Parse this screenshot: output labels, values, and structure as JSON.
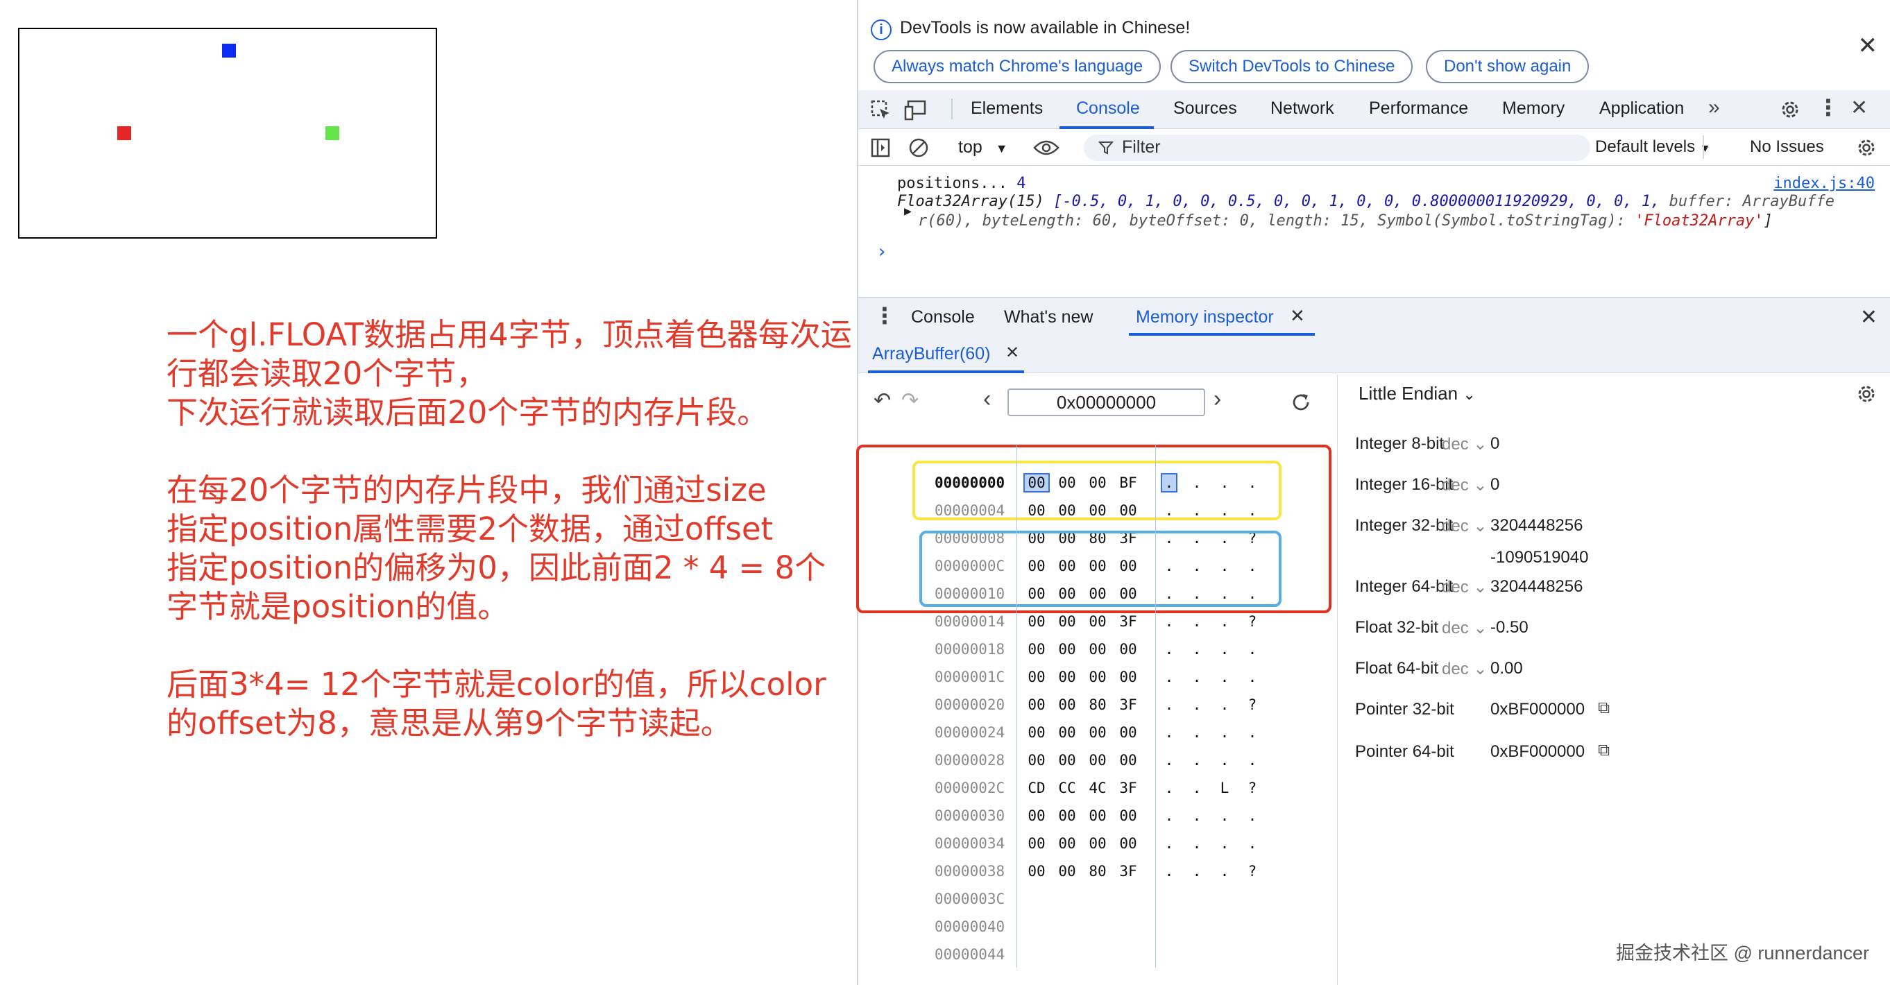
{
  "colors": {
    "annotation": "#e13a2a",
    "accent": "#1a5dd8",
    "square_blue": "#0a2cf0",
    "square_red": "#e32727",
    "square_green": "#66e64a",
    "highlight_yellow": "#f7e645",
    "highlight_blue": "#56aee6",
    "highlight_red": "#e0331f"
  },
  "annotation": {
    "p1": "一个gl.FLOAT数据占用4字节，顶点着色器每次运行都会读取20个字节，\n下次运行就读取后面20个字节的内存片段。",
    "p2": "在每20个字节的内存片段中，我们通过size\n指定position属性需要2个数据，通过offset\n指定position的偏移为0，因此前面2 * 4 = 8个\n字节就是position的值。",
    "p3": "后面3*4= 12个字节就是color的值，所以color\n的offset为8，意思是从第9个字节读起。"
  },
  "infobar": {
    "message": "DevTools is now available in Chinese!",
    "btn_match": "Always match Chrome's language",
    "btn_switch": "Switch DevTools to Chinese",
    "btn_dont": "Don't show again"
  },
  "tabs": {
    "elements": "Elements",
    "console": "Console",
    "sources": "Sources",
    "network": "Network",
    "performance": "Performance",
    "memory": "Memory",
    "application": "Application"
  },
  "toolbar": {
    "context": "top",
    "filter": "Filter",
    "levels": "Default levels",
    "issues": "No Issues"
  },
  "console": {
    "log_label": "positions...",
    "log_value": "4",
    "source_link": "index.js:40",
    "line1_type": "Float32Array(15)",
    "line1_values": "[-0.5, 0, 1, 0, 0, 0.5, 0, 0, 1, 0, 0, 0.800000011920929, 0, 0, 1,",
    "line1_tail": "buffer: ArrayBuffe",
    "line2": "r(60), byteLength: 60, byteOffset: 0, length: 15, Symbol(Symbol.toStringTag): ",
    "line2_str": "'Float32Array'",
    "line2_end": "]"
  },
  "drawer": {
    "tab_console": "Console",
    "tab_whatsnew": "What's new",
    "tab_memory": "Memory inspector",
    "subtab": "ArrayBuffer(60)"
  },
  "memory": {
    "address": "0x00000000",
    "endianness": "Little Endian",
    "rows": [
      {
        "addr": "00000000",
        "bytes": [
          "00",
          "00",
          "00",
          "BF"
        ],
        "ascii": [
          ".",
          ".",
          ".",
          "."
        ]
      },
      {
        "addr": "00000004",
        "bytes": [
          "00",
          "00",
          "00",
          "00"
        ],
        "ascii": [
          ".",
          ".",
          ".",
          "."
        ]
      },
      {
        "addr": "00000008",
        "bytes": [
          "00",
          "00",
          "80",
          "3F"
        ],
        "ascii": [
          ".",
          ".",
          ".",
          "?"
        ]
      },
      {
        "addr": "0000000C",
        "bytes": [
          "00",
          "00",
          "00",
          "00"
        ],
        "ascii": [
          ".",
          ".",
          ".",
          "."
        ]
      },
      {
        "addr": "00000010",
        "bytes": [
          "00",
          "00",
          "00",
          "00"
        ],
        "ascii": [
          ".",
          ".",
          ".",
          "."
        ]
      },
      {
        "addr": "00000014",
        "bytes": [
          "00",
          "00",
          "00",
          "3F"
        ],
        "ascii": [
          ".",
          ".",
          ".",
          "?"
        ]
      },
      {
        "addr": "00000018",
        "bytes": [
          "00",
          "00",
          "00",
          "00"
        ],
        "ascii": [
          ".",
          ".",
          ".",
          "."
        ]
      },
      {
        "addr": "0000001C",
        "bytes": [
          "00",
          "00",
          "00",
          "00"
        ],
        "ascii": [
          ".",
          ".",
          ".",
          "."
        ]
      },
      {
        "addr": "00000020",
        "bytes": [
          "00",
          "00",
          "80",
          "3F"
        ],
        "ascii": [
          ".",
          ".",
          ".",
          "?"
        ]
      },
      {
        "addr": "00000024",
        "bytes": [
          "00",
          "00",
          "00",
          "00"
        ],
        "ascii": [
          ".",
          ".",
          ".",
          "."
        ]
      },
      {
        "addr": "00000028",
        "bytes": [
          "00",
          "00",
          "00",
          "00"
        ],
        "ascii": [
          ".",
          ".",
          ".",
          "."
        ]
      },
      {
        "addr": "0000002C",
        "bytes": [
          "CD",
          "CC",
          "4C",
          "3F"
        ],
        "ascii": [
          ".",
          ".",
          "L",
          "?"
        ]
      },
      {
        "addr": "00000030",
        "bytes": [
          "00",
          "00",
          "00",
          "00"
        ],
        "ascii": [
          ".",
          ".",
          ".",
          "."
        ]
      },
      {
        "addr": "00000034",
        "bytes": [
          "00",
          "00",
          "00",
          "00"
        ],
        "ascii": [
          ".",
          ".",
          ".",
          "."
        ]
      },
      {
        "addr": "00000038",
        "bytes": [
          "00",
          "00",
          "80",
          "3F"
        ],
        "ascii": [
          ".",
          ".",
          ".",
          "?"
        ]
      },
      {
        "addr": "0000003C",
        "bytes": [],
        "ascii": []
      },
      {
        "addr": "00000040",
        "bytes": [],
        "ascii": []
      },
      {
        "addr": "00000044",
        "bytes": [],
        "ascii": []
      }
    ],
    "values": [
      {
        "label": "Integer 8-bit",
        "format": "dec",
        "value": "0"
      },
      {
        "label": "Integer 16-bit",
        "format": "dec",
        "value": "0"
      },
      {
        "label": "Integer 32-bit",
        "format": "dec",
        "value": "3204448256",
        "value2": "-1090519040"
      },
      {
        "label": "Integer 64-bit",
        "format": "dec",
        "value": "3204448256"
      },
      {
        "label": "Float 32-bit",
        "format": "dec",
        "value": "-0.50"
      },
      {
        "label": "Float 64-bit",
        "format": "dec",
        "value": "0.00"
      },
      {
        "label": "Pointer 32-bit",
        "format": "",
        "value": "0xBF000000"
      },
      {
        "label": "Pointer 64-bit",
        "format": "",
        "value": "0xBF000000"
      }
    ]
  },
  "watermark": "掘金技术社区 @ runnerdancer"
}
